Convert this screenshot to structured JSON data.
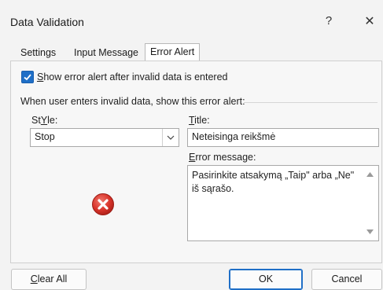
{
  "window": {
    "title": "Data Validation",
    "help_glyph": "?",
    "close_glyph": "✕"
  },
  "tabs": [
    {
      "label": "Settings",
      "active": false
    },
    {
      "label": "Input Message",
      "active": false
    },
    {
      "label": "Error Alert",
      "active": true
    }
  ],
  "show_alert": {
    "checked": true,
    "label_first": "S",
    "label_rest": "how error alert after invalid data is entered"
  },
  "group_label": "When user enters invalid data, show this error alert:",
  "style": {
    "label_first": "Y",
    "label_prefix": "St",
    "label_rest": "le:",
    "value": "Stop",
    "icon": "error-stop-icon"
  },
  "title_field": {
    "label_first": "T",
    "label_rest": "itle:",
    "value": "Neteisinga reikšmė"
  },
  "error_message": {
    "label_first": "E",
    "label_rest": "rror message:",
    "value": "Pasirinkite atsakymą „Taip\" arba „Ne\" iš sąrašo."
  },
  "buttons": {
    "clear_first": "C",
    "clear_rest": "lear All",
    "ok": "OK",
    "cancel": "Cancel"
  },
  "colors": {
    "accent": "#1f6fc7",
    "error_icon": "#d9342b"
  }
}
